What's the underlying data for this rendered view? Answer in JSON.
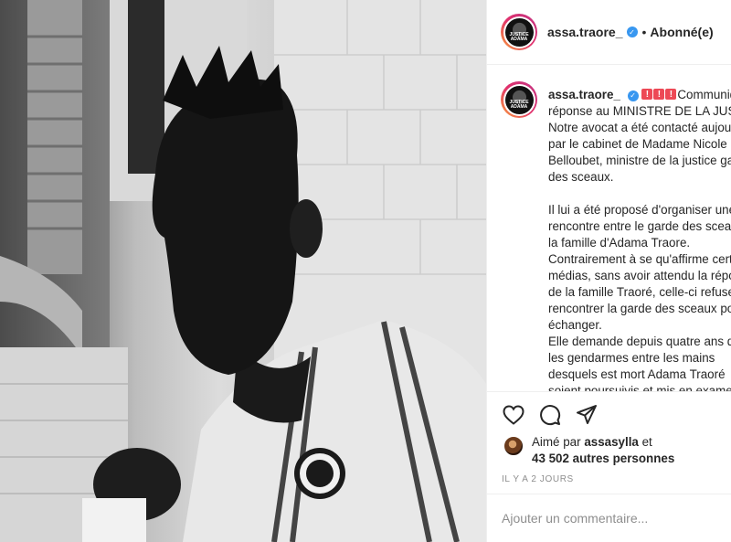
{
  "post": {
    "photo_alt": "Photo en noir et blanc",
    "username": "assa.traore_",
    "follow_status": "Abonné(e)",
    "dot": "•",
    "avatar_text": "JUSTICE ADAMA"
  },
  "caption": {
    "username": "assa.traore_",
    "line1": "Communiqué",
    "lines": [
      "réponse au MINISTRE DE LA JUSTICE",
      "Notre avocat a été contacté aujourd'hui",
      "par le cabinet de Madame Nicole",
      "Belloubet, ministre de la justice garde",
      "des sceaux.",
      "",
      "Il lui a été proposé d'organiser une",
      "rencontre entre le garde des sceaux et",
      "la famille d'Adama Traore.",
      "Contrairement à se qu'affirme certains",
      "médias, sans avoir attendu la réponse",
      "de la famille Traoré, celle-ci refuse de",
      "rencontrer la garde des sceaux pour",
      "échanger.",
      "Elle demande depuis quatre ans que",
      "les gendarmes entre les mains",
      "desquels est mort Adama Traoré",
      "soient poursuivis et mis en examen"
    ]
  },
  "actions": {
    "like_icon": "heart-icon",
    "comment_icon": "comment-icon",
    "share_icon": "share-icon"
  },
  "likes": {
    "prefix": "Aimé par ",
    "user": "assasylla",
    "mid": " et",
    "count": "43 502 autres personnes"
  },
  "timestamp": "IL Y A 2 JOURS",
  "comment": {
    "placeholder": "Ajouter un commentaire..."
  },
  "colors": {
    "verified": "#3897f0",
    "border": "#efefef",
    "muted": "#8e8e8e",
    "text": "#262626"
  }
}
